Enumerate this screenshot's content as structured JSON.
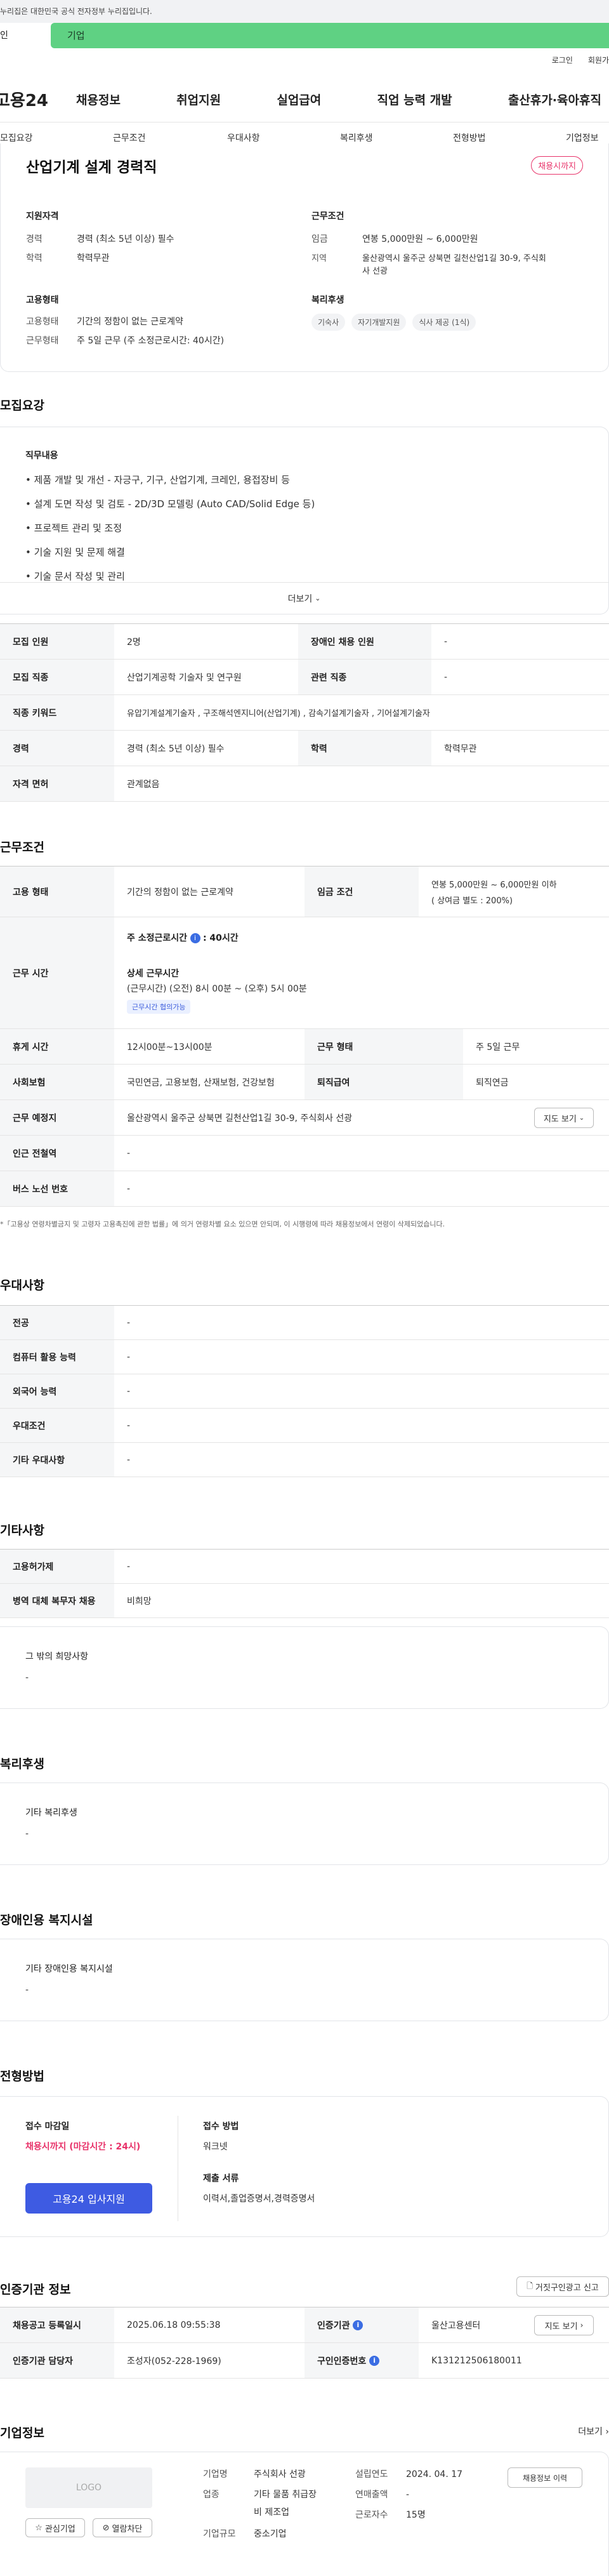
{
  "gov_bar": {
    "text": "누리집은 대한민국 공식 전자정부 누리집입니다."
  },
  "audience": {
    "left_label": "인",
    "active_label": "기업"
  },
  "top_links": {
    "login": "로그인",
    "join": "회원가"
  },
  "gnb": {
    "logo": "고용24",
    "menu": [
      "채용정보",
      "취업지원",
      "실업급여",
      "직업 능력 개발",
      "출산휴가·육아휴직"
    ]
  },
  "subtabs": [
    "모집요강",
    "근무조건",
    "우대사항",
    "복리후생",
    "전형방법",
    "기업정보"
  ],
  "summary": {
    "title": "산업기계 설계 경력직",
    "badge": "채용시까지",
    "qual_title": "지원자격",
    "qual": [
      {
        "k": "경력",
        "v": "경력 (최소 5년 이상) 필수"
      },
      {
        "k": "학력",
        "v": "학력무관"
      }
    ],
    "cond_title": "근무조건",
    "cond": [
      {
        "k": "임금",
        "v": "연봉 5,000만원 ~ 6,000만원"
      },
      {
        "k": "지역",
        "v": "울산광역시 울주군 상북면 길천산업1길 30-9, 주식회"
      },
      {
        "k": "",
        "v": "사 선광"
      }
    ],
    "emp_title": "고용형태",
    "emp": [
      {
        "k": "고용형태",
        "v": "기간의 정함이 없는 근로계약"
      },
      {
        "k": "근무형태",
        "v": "주 5일 근무 (주 소정근로시간: 40시간)"
      }
    ],
    "welfare_title": "복리후생",
    "welfare_chips": [
      "기숙사",
      "자기개발지원",
      "식사 제공 (1식)"
    ]
  },
  "recruit": {
    "section_title": "모집요강",
    "duty_title": "직무내용",
    "duties": [
      "• 제품 개발 및 개선 - 자긍구, 기구, 산업기계, 크레인, 용접장비 등",
      "• 설계 도면 작성 및 검토 - 2D/3D 모델링 (Auto CAD/Solid Edge 등)",
      "• 프로젝트 관리 및 조정",
      "• 기술 지원 및 문제 해결",
      "• 기술 문서 작성 및 관리"
    ],
    "more": "더보기",
    "table": [
      {
        "k1": "모집 인원",
        "v1": "2명",
        "k2": "장애인 채용 인원",
        "v2": "-"
      },
      {
        "k1": "모집 직종",
        "v1": "산업기계공학 기술자 및 연구원",
        "k2": "관련 직종",
        "v2": "-"
      },
      {
        "k1": "직종 키워드",
        "v1": "유압기계설계기술자 , 구조해석엔지니어(산업기계) , 감속기설계기술자 , 기어설계기술자",
        "k2": "",
        "v2": ""
      },
      {
        "k1": "경력",
        "v1": "경력 (최소 5년 이상) 필수",
        "k2": "학력",
        "v2": "학력무관"
      },
      {
        "k1": "자격 면허",
        "v1": "관계없음",
        "k2": "",
        "v2": ""
      }
    ]
  },
  "work": {
    "section_title": "근무조건",
    "emp_k": "고용 형태",
    "emp_v": "기간의 정함이 없는 근로계약",
    "wage_k": "임금 조건",
    "wage_v1": "연봉 5,000만원 ~ 6,000만원 이하",
    "wage_v2": "( 상여금 별도 : 200%)",
    "hours_k": "근무 시간",
    "hours_label": "주 소정근로시간",
    "hours_value": ": 40시간",
    "detail_label": "상세 근무시간",
    "detail_value": "(근무시간) (오전) 8시 00분 ~ (오후) 5시 00분",
    "tag": "근무시간 협의가능",
    "rest_k": "휴게 시간",
    "rest_v": "12시00분~13시00분",
    "shift_k": "근무 형태",
    "shift_v": "주 5일 근무",
    "ins_k": "사회보험",
    "ins_v": "국민연금, 고용보험, 산재보험, 건강보험",
    "pension_k": "퇴직급여",
    "pension_v": "퇴직연금",
    "place_k": "근무 예정지",
    "place_v": "울산광역시 울주군 상북면 길천산업1길 30-9, 주식회사 선광",
    "map_btn": "지도 보기",
    "station_k": "인근 전철역",
    "station_v": "-",
    "bus_k": "버스 노선 번호",
    "bus_v": "-",
    "note": "*「고용상 연령차별금지 및 고령자 고용촉진에 관한 법률」에 의거 연령차별 요소 있으면 안되며, 이 시행령에 따라 채용정보에서 연령이 삭제되었습니다."
  },
  "prefer": {
    "section_title": "우대사항",
    "rows": [
      {
        "k": "전공",
        "v": "-"
      },
      {
        "k": "컴퓨터 활용 능력",
        "v": "-"
      },
      {
        "k": "외국어 능력",
        "v": "-"
      },
      {
        "k": "우대조건",
        "v": "-"
      },
      {
        "k": "기타 우대사항",
        "v": "-"
      }
    ]
  },
  "other": {
    "section_title": "기타사항",
    "rows": [
      {
        "k": "고용허가제",
        "v": "-"
      },
      {
        "k": "병역 대체 복무자 채용",
        "v": "비희망"
      }
    ],
    "box_title": "그 밖의 희망사항",
    "box_value": "-"
  },
  "welfare": {
    "section_title": "복리후생",
    "box_title": "기타 복리후생",
    "box_value": "-"
  },
  "disabled": {
    "section_title": "장애인용 복지시설",
    "box_title": "기타 장애인용 복지시설",
    "box_value": "-"
  },
  "selection": {
    "section_title": "전형방법",
    "deadline_title": "접수 마감일",
    "deadline_value": "채용시까지 (마감시간 : 24시)",
    "apply_btn": "고용24 입사지원",
    "method_title": "접수 방법",
    "method_value": "워크넷",
    "docs_title": "제출 서류",
    "docs_value": "이력서,졸업증명서,경력증명서"
  },
  "cert": {
    "section_title": "인증기관 정보",
    "report_btn": "거짓구인광고 신고",
    "reg_k": "채용공고 등록일시",
    "reg_v": "2025.06.18 09:55:38",
    "org_k": "인증기관",
    "org_v": "울산고용센터",
    "map_btn": "지도 보기",
    "mgr_k": "인증기관 담당자",
    "mgr_v": "조성자(052-228-1969)",
    "num_k": "구인인증번호",
    "num_v": "K131212506180011"
  },
  "company": {
    "section_title": "기업정보",
    "more": "더보기",
    "logo": "LOGO",
    "fav_btn": "관심기업",
    "block_btn": "열람차단",
    "fields": [
      {
        "k": "기업명",
        "v": "주식회사 선광"
      },
      {
        "k": "업종",
        "v": "기타 물품 취급장"
      },
      {
        "k": "",
        "v": "비 제조업"
      },
      {
        "k": "기업규모",
        "v": "중소기업"
      }
    ],
    "fields2": [
      {
        "k": "설립연도",
        "v": "2024. 04. 17"
      },
      {
        "k": "연매출액",
        "v": "-"
      },
      {
        "k": "근로자수",
        "v": "15명"
      }
    ],
    "jobs_btn": "채용정보 이력"
  }
}
